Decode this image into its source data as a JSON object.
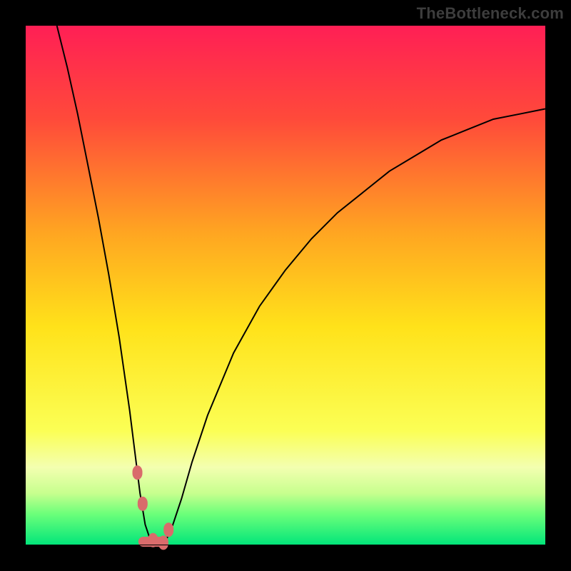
{
  "watermark": "TheBottleneck.com",
  "colors": {
    "frame": "#000000",
    "gradient_stops": [
      {
        "pct": 0,
        "color": "#ff1f55"
      },
      {
        "pct": 18,
        "color": "#ff4a3a"
      },
      {
        "pct": 40,
        "color": "#ffa621"
      },
      {
        "pct": 58,
        "color": "#ffe21a"
      },
      {
        "pct": 78,
        "color": "#fbff55"
      },
      {
        "pct": 85,
        "color": "#f3ffb0"
      },
      {
        "pct": 90,
        "color": "#c7ff8e"
      },
      {
        "pct": 94,
        "color": "#6bff7a"
      },
      {
        "pct": 100,
        "color": "#00e57a"
      }
    ],
    "curve": "#000000",
    "marker": "#d96b6b"
  },
  "chart_data": {
    "type": "line",
    "title": "",
    "xlabel": "",
    "ylabel": "",
    "xlim": [
      0,
      100
    ],
    "ylim": [
      0,
      100
    ],
    "x": [
      6,
      8,
      10,
      12,
      14,
      16,
      18,
      20,
      21,
      22,
      23,
      24,
      25,
      26,
      27,
      28,
      30,
      32,
      35,
      40,
      45,
      50,
      55,
      60,
      65,
      70,
      75,
      80,
      85,
      90,
      95,
      100
    ],
    "values": [
      100,
      92,
      83,
      73,
      63,
      52,
      40,
      26,
      18,
      10,
      4,
      1,
      0,
      0,
      1,
      3,
      9,
      16,
      25,
      37,
      46,
      53,
      59,
      64,
      68,
      72,
      75,
      78,
      80,
      82,
      83,
      84
    ],
    "minimum_x": 25,
    "markers_x": [
      21.5,
      22.5,
      24.5,
      26.5,
      27.5
    ],
    "markers_y": [
      14,
      8,
      1,
      0.5,
      3
    ]
  }
}
